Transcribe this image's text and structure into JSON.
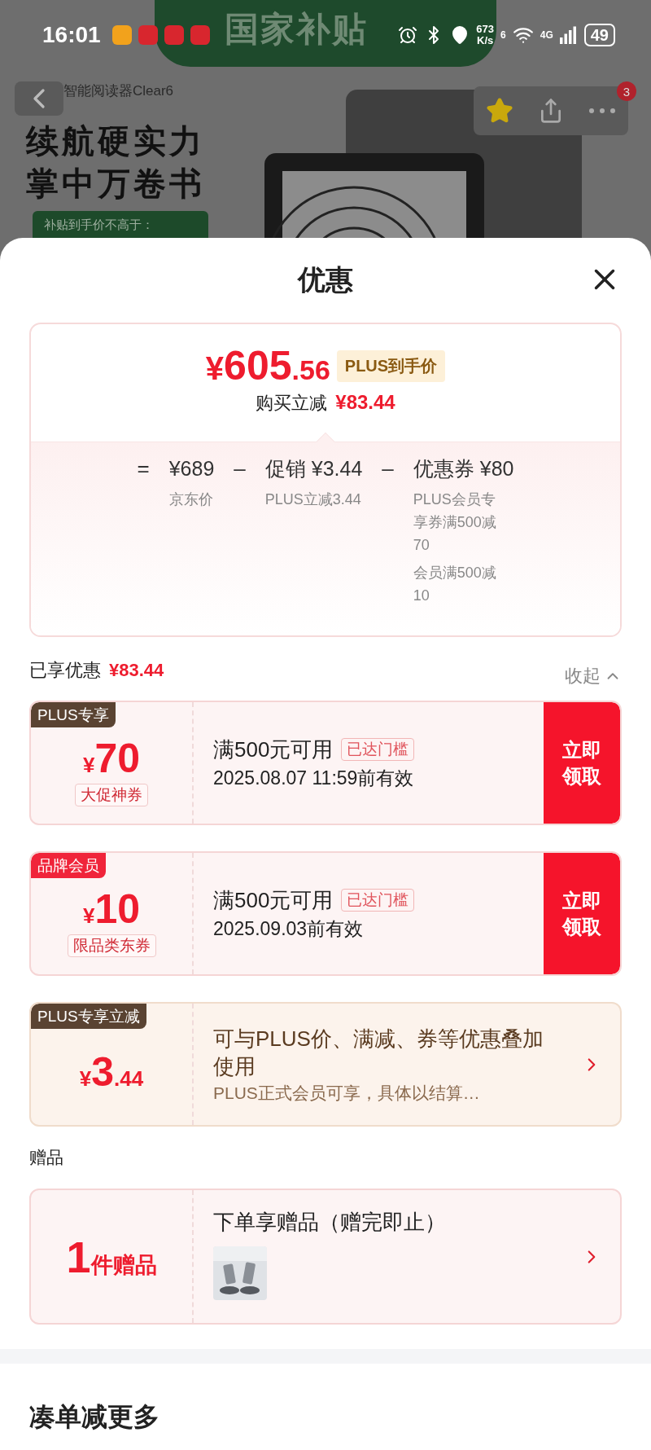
{
  "status_bar": {
    "time": "16:01",
    "speed_value": "673",
    "speed_unit": "K/s",
    "wifi_label": "6",
    "cell_label": "4G",
    "battery": "49"
  },
  "banner": {
    "campaign": "国家补贴",
    "product_name": "智能阅读器Clear6",
    "slogan_lines": [
      "续航硬实力",
      "掌中万卷书"
    ],
    "subsidy_label": "补贴到手价不高于："
  },
  "nav": {
    "favorited": true,
    "more_badge": "3"
  },
  "sheet": {
    "title": "优惠"
  },
  "price_summary": {
    "currency": "¥",
    "integer": "605",
    "decimal": ".56",
    "tag": "PLUS到手价",
    "saving_label": "购买立减",
    "saving_amount": "¥83.44",
    "breakdown": [
      {
        "operator": "=",
        "value": "¥689",
        "notes": [
          "京东价"
        ]
      },
      {
        "operator": "–",
        "label": "促销",
        "value": "¥3.44",
        "notes": [
          "PLUS立减3.44"
        ]
      },
      {
        "operator": "–",
        "label": "优惠券",
        "value": "¥80",
        "notes": [
          "PLUS会员专享券满500减70",
          "会员满500减10"
        ]
      }
    ]
  },
  "enjoyed": {
    "label": "已享优惠",
    "amount": "¥83.44",
    "toggle": "收起",
    "expanded": true
  },
  "coupons": [
    {
      "kind": "coupon",
      "tag": "PLUS专享",
      "color": "#5a4332",
      "currency": "¥",
      "amount": "70",
      "type_label": "大促神券",
      "condition": "满500元可用",
      "status": "已达门槛",
      "validity": "2025.08.07 11:59前有效",
      "action": "立即领取"
    },
    {
      "kind": "coupon",
      "tag": "品牌会员",
      "color": "#f0243a",
      "currency": "¥",
      "amount": "10",
      "type_label": "限品类东券",
      "condition": "满500元可用",
      "status": "已达门槛",
      "validity": "2025.09.03前有效",
      "action": "立即领取"
    },
    {
      "kind": "instant",
      "tag": "PLUS专享立减",
      "color": "#5a4332",
      "currency": "¥",
      "amount": "3",
      "decimal": ".44",
      "description": "可与PLUS价、满减、券等优惠叠加使用",
      "note": "PLUS正式会员可享，具体以结算…"
    }
  ],
  "gifts": {
    "title": "赠品",
    "count": "1",
    "count_unit": "件赠品",
    "description": "下单享赠品（赠完即止）"
  },
  "more": {
    "title": "凑单减更多"
  }
}
